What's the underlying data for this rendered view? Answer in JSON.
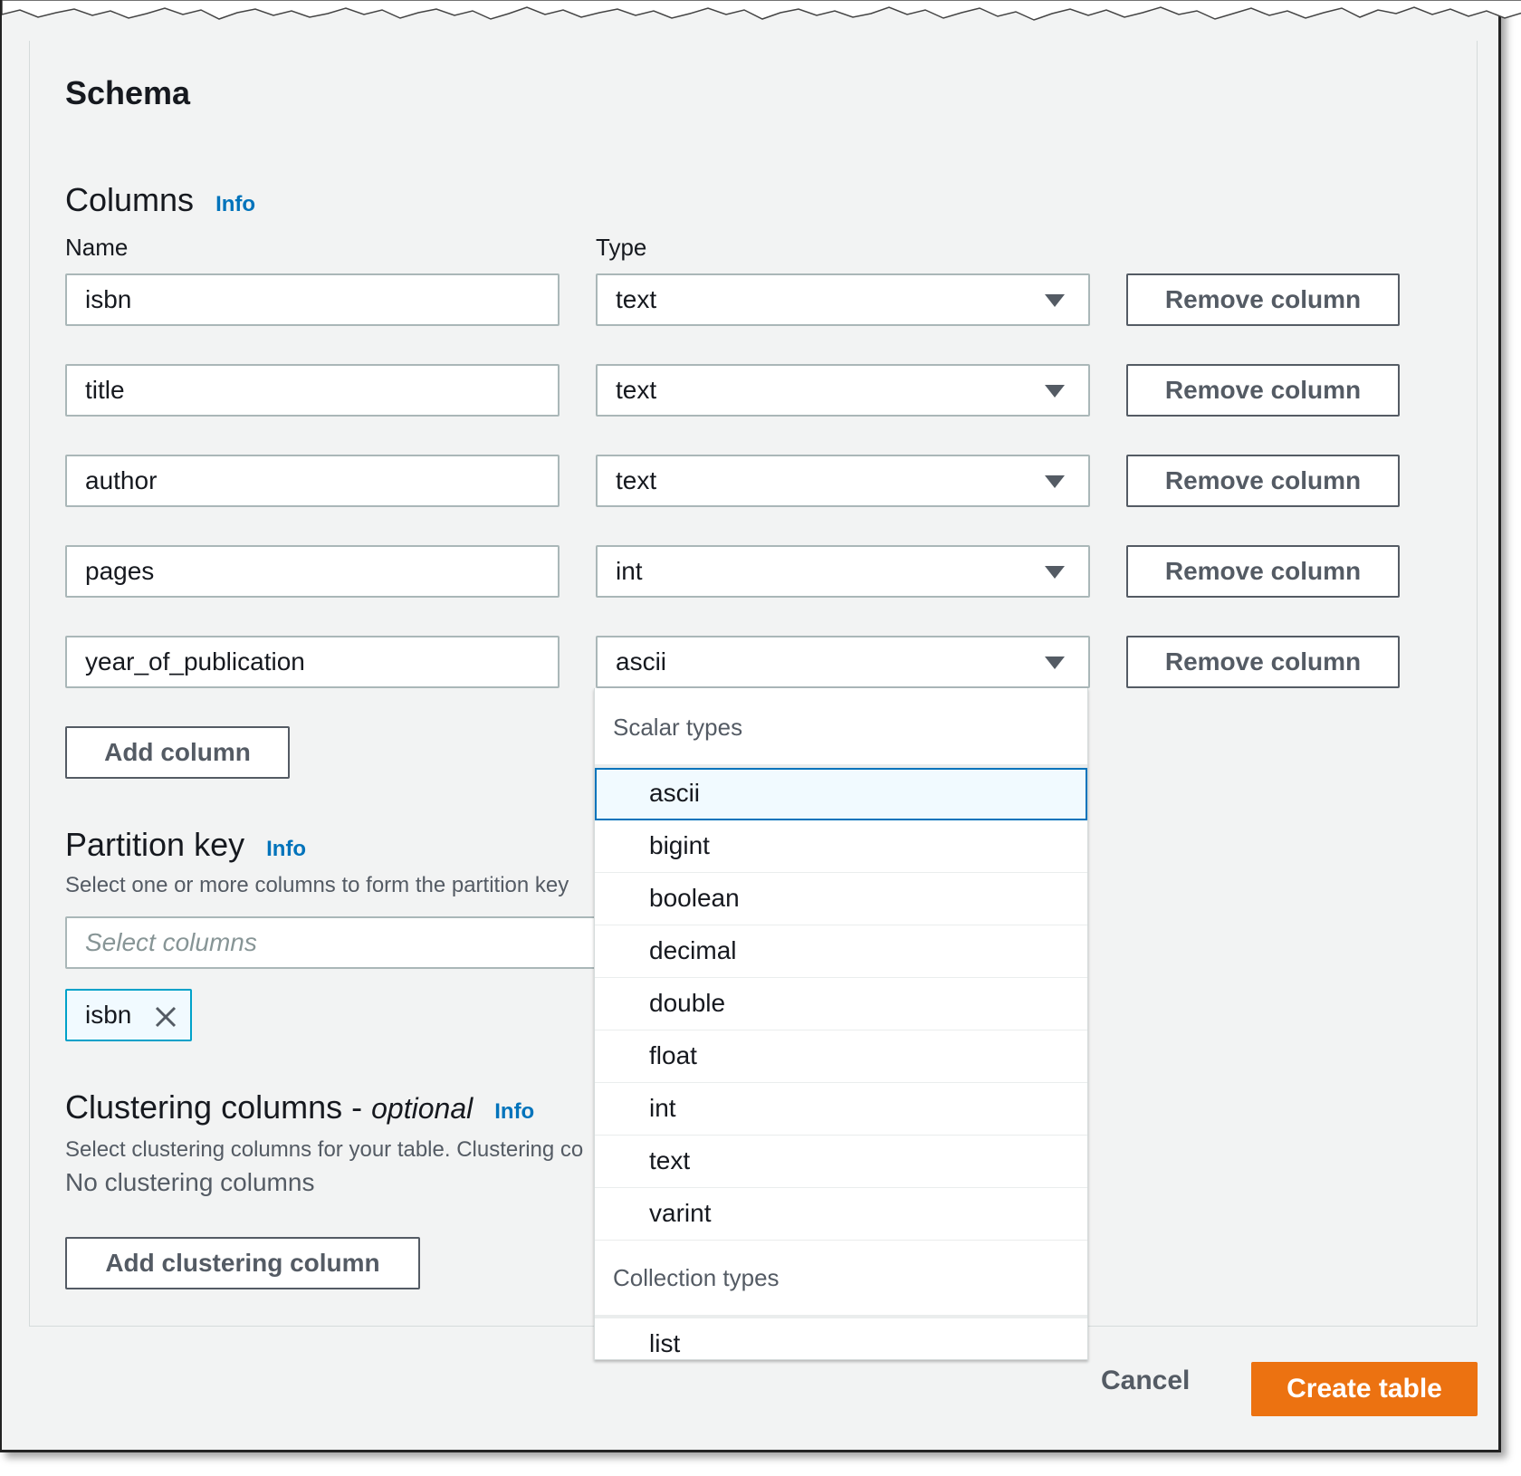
{
  "schema": {
    "title": "Schema"
  },
  "columns": {
    "heading": "Columns",
    "info": "Info",
    "name_label": "Name",
    "type_label": "Type",
    "remove_label": "Remove column",
    "rows": [
      {
        "name": "isbn",
        "type": "text"
      },
      {
        "name": "title",
        "type": "text"
      },
      {
        "name": "author",
        "type": "text"
      },
      {
        "name": "pages",
        "type": "int"
      },
      {
        "name": "year_of_publication",
        "type": "ascii"
      }
    ],
    "add_label": "Add column"
  },
  "type_dropdown": {
    "scalar_label": "Scalar types",
    "scalar_options": [
      "ascii",
      "bigint",
      "boolean",
      "decimal",
      "double",
      "float",
      "int",
      "text",
      "varint"
    ],
    "highlighted": "ascii",
    "collection_label": "Collection types",
    "collection_options": [
      "list"
    ]
  },
  "partition_key": {
    "heading": "Partition key",
    "info": "Info",
    "description": "Select one or more columns to form the partition key",
    "placeholder": "Select columns",
    "selected_token": "isbn"
  },
  "clustering": {
    "heading": "Clustering columns - ",
    "heading_optional": "optional",
    "info": "Info",
    "description": "Select clustering columns for your table. Clustering co",
    "empty_text": "No clustering columns",
    "add_label": "Add clustering column"
  },
  "footer": {
    "cancel_label": "Cancel",
    "create_label": "Create table"
  },
  "colors": {
    "primary_button": "#ec7211",
    "link": "#0073bb",
    "token_border": "#00a1c9"
  }
}
